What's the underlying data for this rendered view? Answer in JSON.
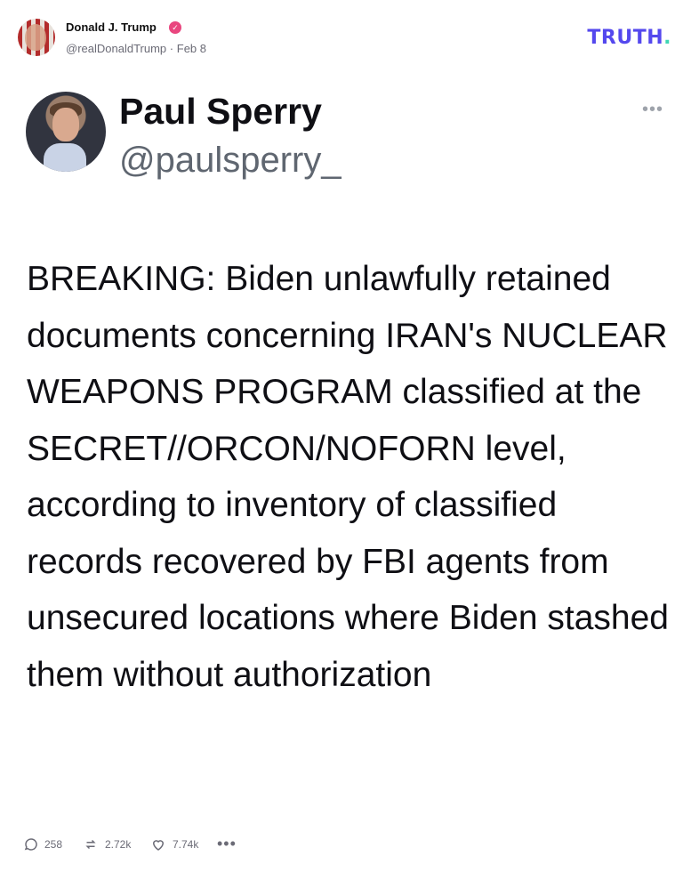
{
  "post": {
    "author_name": "Donald J. Trump",
    "handle": "@realDonaldTrump",
    "separator": "·",
    "date": "Feb 8",
    "logo_text": "TRUTH",
    "logo_dot": "."
  },
  "quoted": {
    "name": "Paul Sperry",
    "handle": "@paulsperry_",
    "menu_icon": "more-horizontal-icon",
    "text": "BREAKING: Biden unlawfully retained documents concerning IRAN's NUCLEAR WEAPONS PROGRAM classified at the SECRET//ORCON/NOFORN level, according to inventory of classified records recovered by FBI agents from unsecured locations where Biden stashed them without authorization"
  },
  "actions": {
    "replies": "258",
    "retruths": "2.72k",
    "likes": "7.74k",
    "more": "•••"
  },
  "colors": {
    "brand": "#5448ee",
    "brand_accent": "#3fd6b4",
    "verified": "#e9467f",
    "muted": "#6b6b76"
  }
}
